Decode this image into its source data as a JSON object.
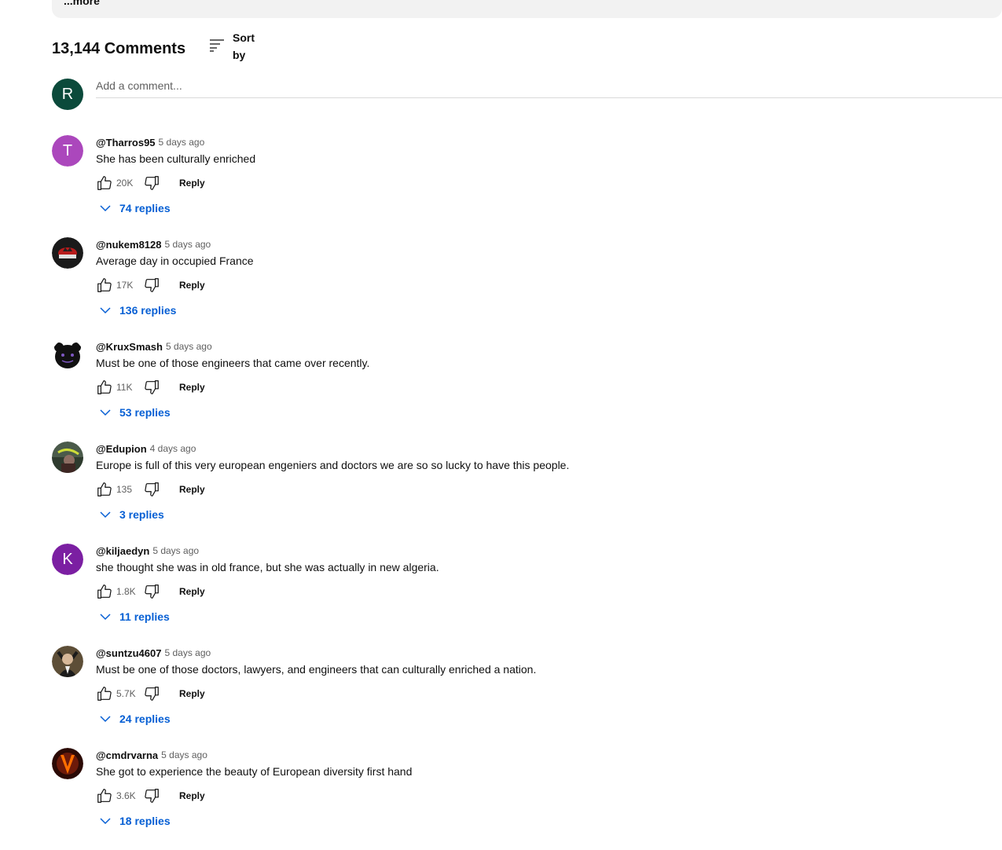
{
  "description": {
    "more_label": "...more"
  },
  "header": {
    "comment_count": "13,144 Comments",
    "sort_label": "Sort by"
  },
  "add_comment": {
    "avatar_letter": "R",
    "avatar_color": "#0b4a3b",
    "placeholder": "Add a comment..."
  },
  "comments": [
    {
      "author": "@Tharros95",
      "time": "5 days ago",
      "text": "She has been culturally enriched",
      "likes": "20K",
      "reply_label": "Reply",
      "replies": "74 replies",
      "avatar_type": "letter",
      "avatar_letter": "T",
      "avatar_color": "#ab47bc"
    },
    {
      "author": "@nukem8128",
      "time": "5 days ago",
      "text": "Average day in occupied France",
      "likes": "17K",
      "reply_label": "Reply",
      "replies": "136 replies",
      "avatar_type": "image",
      "avatar_icon": "dark-emblem-avatar"
    },
    {
      "author": "@KruxSmash",
      "time": "5 days ago",
      "text": "Must be one of those engineers that came over recently.",
      "likes": "11K",
      "reply_label": "Reply",
      "replies": "53 replies",
      "avatar_type": "image",
      "avatar_icon": "black-bear-avatar"
    },
    {
      "author": "@Edupion",
      "time": "4 days ago",
      "text": "Europe is full of this very european engeniers and doctors we are so so lucky to have this people.",
      "likes": "135",
      "reply_label": "Reply",
      "replies": "3 replies",
      "avatar_type": "image",
      "avatar_icon": "photo-avatar"
    },
    {
      "author": "@kiljaedyn",
      "time": "5 days ago",
      "text": "she thought she was in old france, but she was actually in new algeria.",
      "likes": "1.8K",
      "reply_label": "Reply",
      "replies": "11 replies",
      "avatar_type": "letter",
      "avatar_letter": "K",
      "avatar_color": "#7b1fa2"
    },
    {
      "author": "@suntzu4607",
      "time": "5 days ago",
      "text": "Must be one of those doctors, lawyers, and engineers that can culturally enriched a nation.",
      "likes": "5.7K",
      "reply_label": "Reply",
      "replies": "24 replies",
      "avatar_type": "image",
      "avatar_icon": "portrait-avatar"
    },
    {
      "author": "@cmdrvarna",
      "time": "5 days ago",
      "text": "She got to experience the beauty of European diversity first hand",
      "likes": "3.6K",
      "reply_label": "Reply",
      "replies": "18 replies",
      "avatar_type": "image",
      "avatar_icon": "fire-v-avatar"
    }
  ]
}
